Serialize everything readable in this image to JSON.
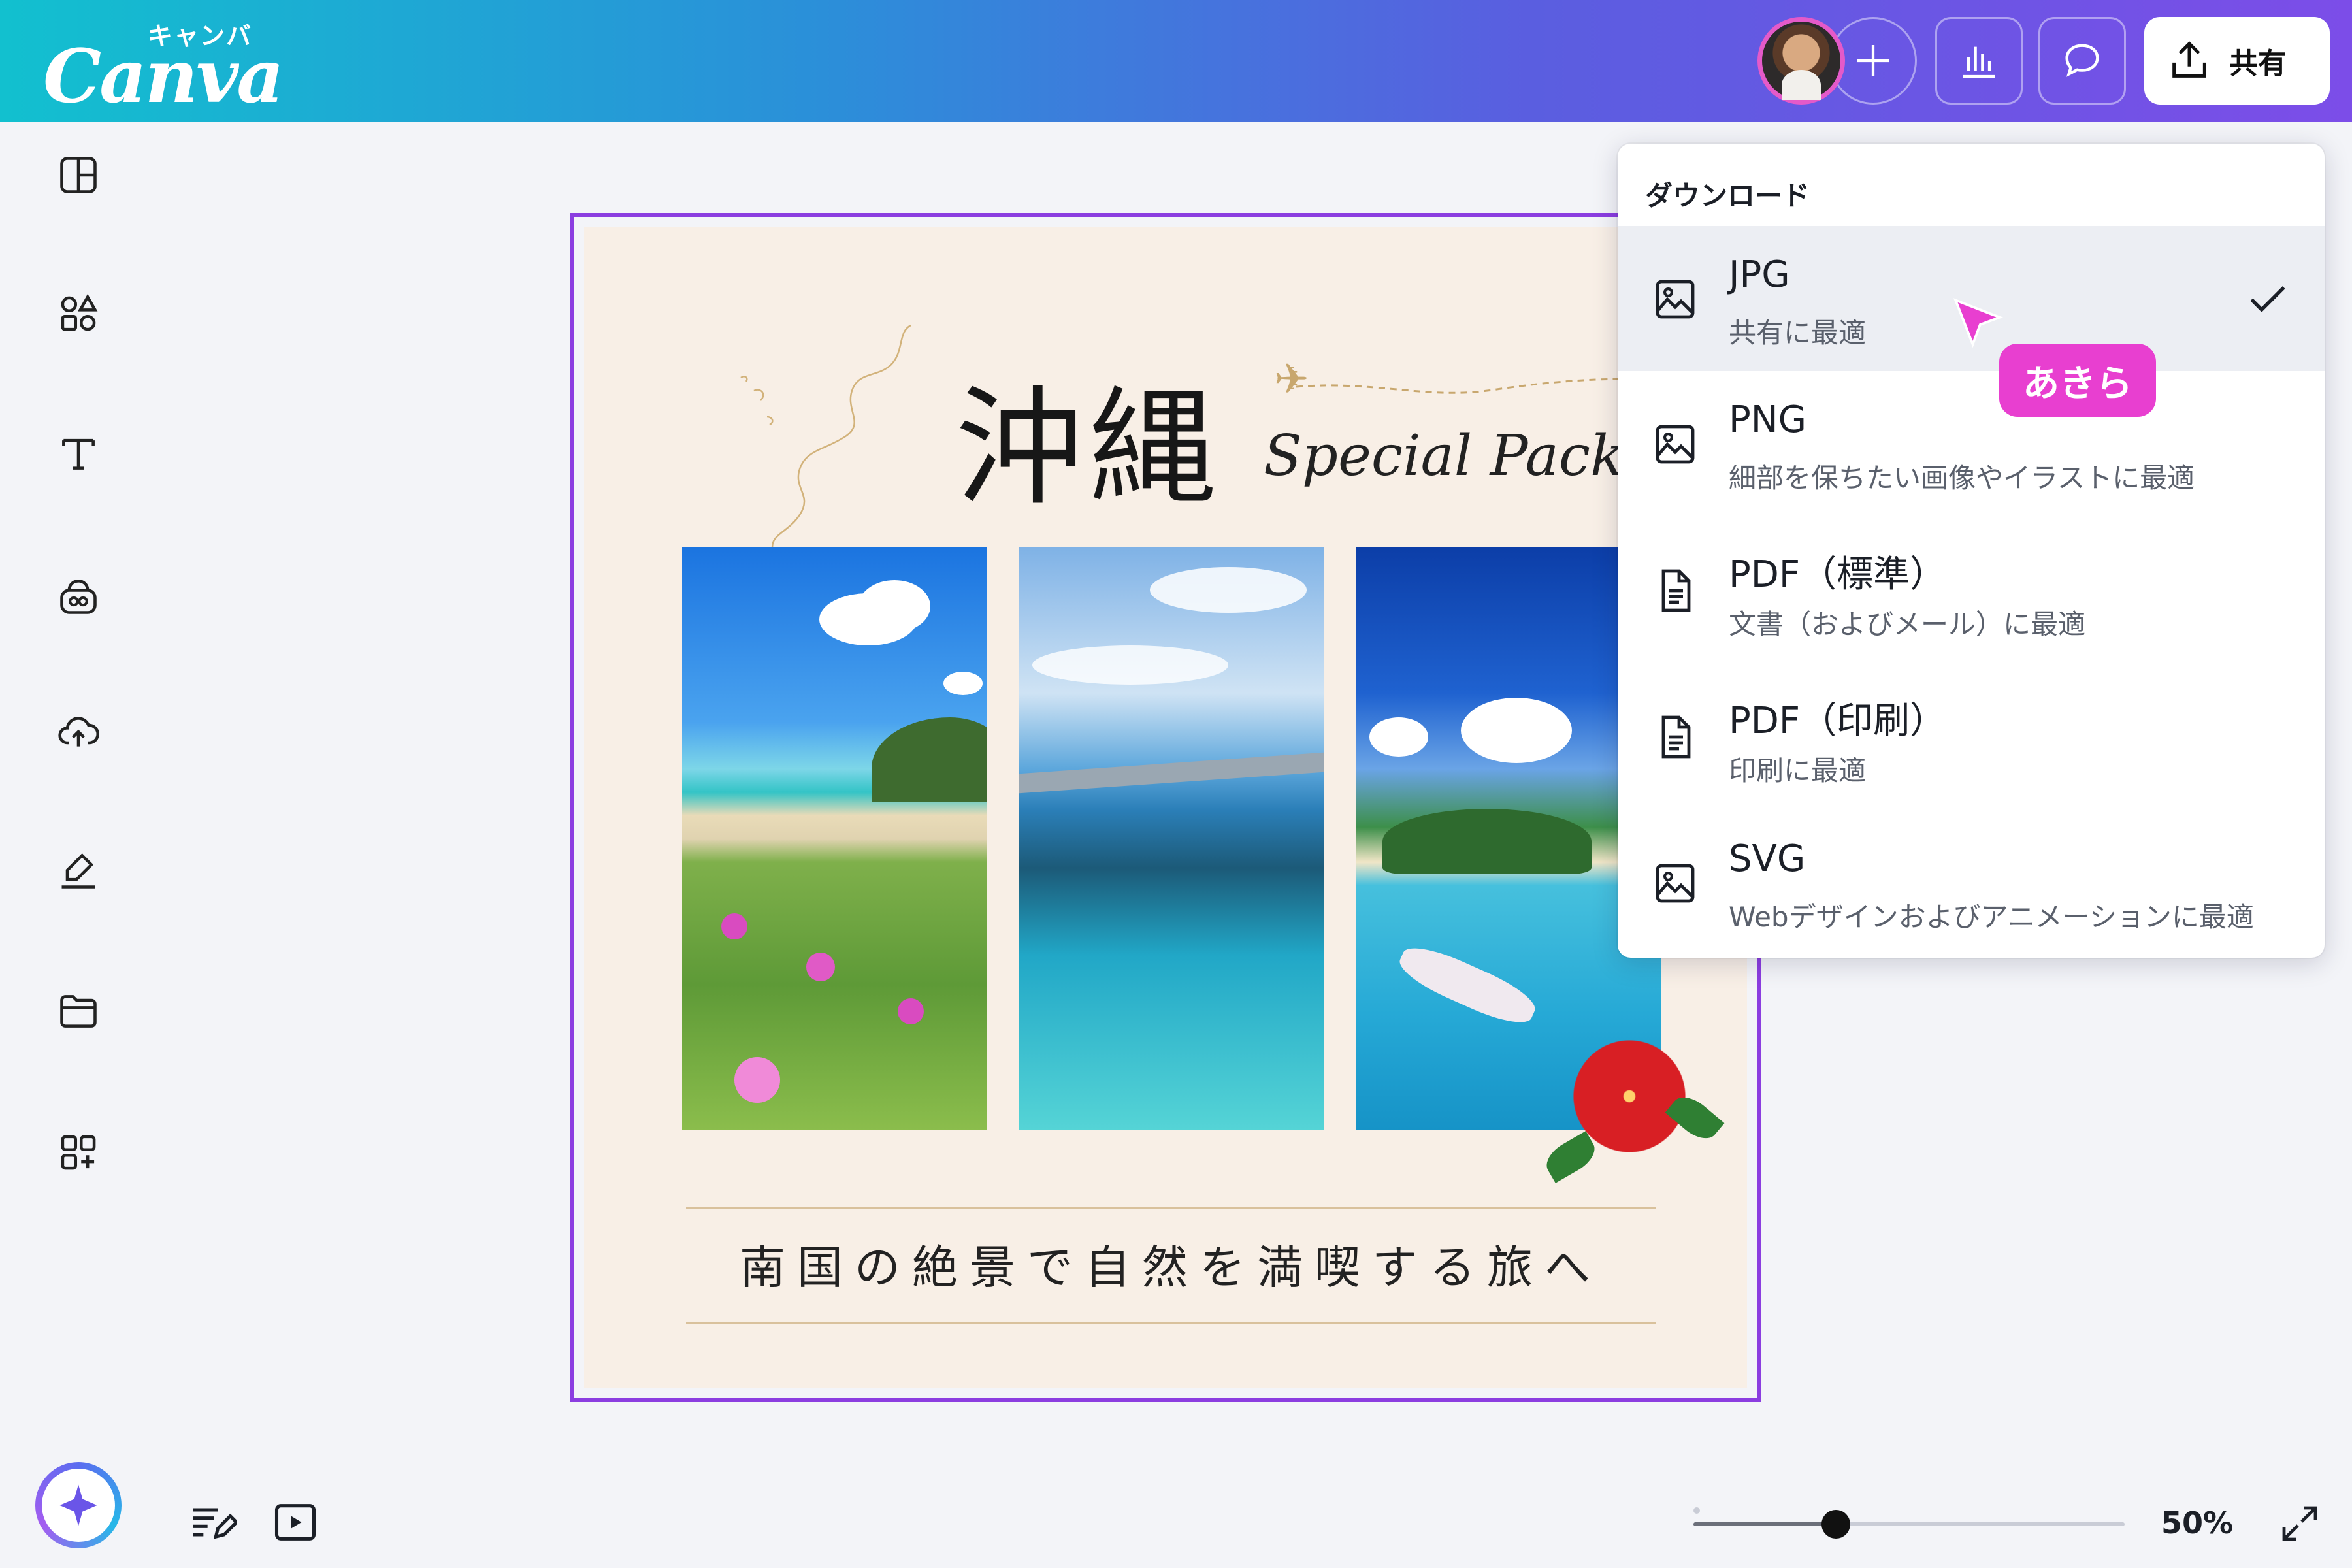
{
  "app": {
    "logo_word": "Canva",
    "logo_kana": "キャンバ",
    "accent": "#8b3de0",
    "topbar_gradient": [
      "#12c0cf",
      "#7c4de8"
    ]
  },
  "header": {
    "share_label": "共有"
  },
  "design": {
    "title_jp": "沖縄",
    "title_en": "Special Package",
    "subtitle": "南国の絶景で自然を満喫する旅へ"
  },
  "download_menu": {
    "title": "ダウンロード",
    "items": [
      {
        "name": "JPG",
        "description": "共有に最適",
        "icon": "image-icon",
        "selected": true
      },
      {
        "name": "PNG",
        "description": "細部を保ちたい画像やイラストに最適",
        "icon": "image-icon",
        "selected": false
      },
      {
        "name": "PDF（標準）",
        "description": "文書（およびメール）に最適",
        "icon": "document-icon",
        "selected": false
      },
      {
        "name": "PDF（印刷）",
        "description": "印刷に最適",
        "icon": "document-icon",
        "selected": false
      },
      {
        "name": "SVG",
        "description": "Webデザインおよびアニメーションに最適",
        "icon": "image-icon",
        "selected": false
      }
    ]
  },
  "collaborator": {
    "name": "あきら",
    "color": "#e83fd0"
  },
  "zoom": {
    "label": "50%",
    "level": 0.5
  }
}
